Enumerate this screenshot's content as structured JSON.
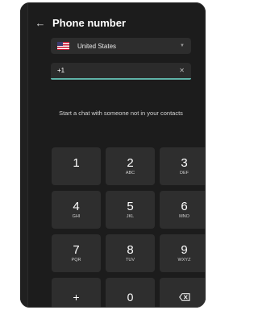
{
  "header": {
    "back_icon": "back-arrow-icon",
    "title": "Phone number"
  },
  "country": {
    "flag_icon": "us-flag-icon",
    "name": "United States"
  },
  "phone": {
    "value": "+1",
    "clear_icon": "close-icon"
  },
  "hint": "Start a chat with someone not in your contacts",
  "keypad": {
    "keys": [
      {
        "digit": "1",
        "letters": ""
      },
      {
        "digit": "2",
        "letters": "ABC"
      },
      {
        "digit": "3",
        "letters": "DEF"
      },
      {
        "digit": "4",
        "letters": "GHI"
      },
      {
        "digit": "5",
        "letters": "JKL"
      },
      {
        "digit": "6",
        "letters": "MNO"
      },
      {
        "digit": "7",
        "letters": "PQR"
      },
      {
        "digit": "8",
        "letters": "TUV"
      },
      {
        "digit": "9",
        "letters": "WXYZ"
      },
      {
        "digit": "+",
        "letters": ""
      },
      {
        "digit": "0",
        "letters": ""
      }
    ],
    "backspace_icon": "backspace-icon"
  },
  "colors": {
    "accent": "#5fb3a8",
    "background": "#1c1c1c",
    "key": "#2e2e2e"
  }
}
